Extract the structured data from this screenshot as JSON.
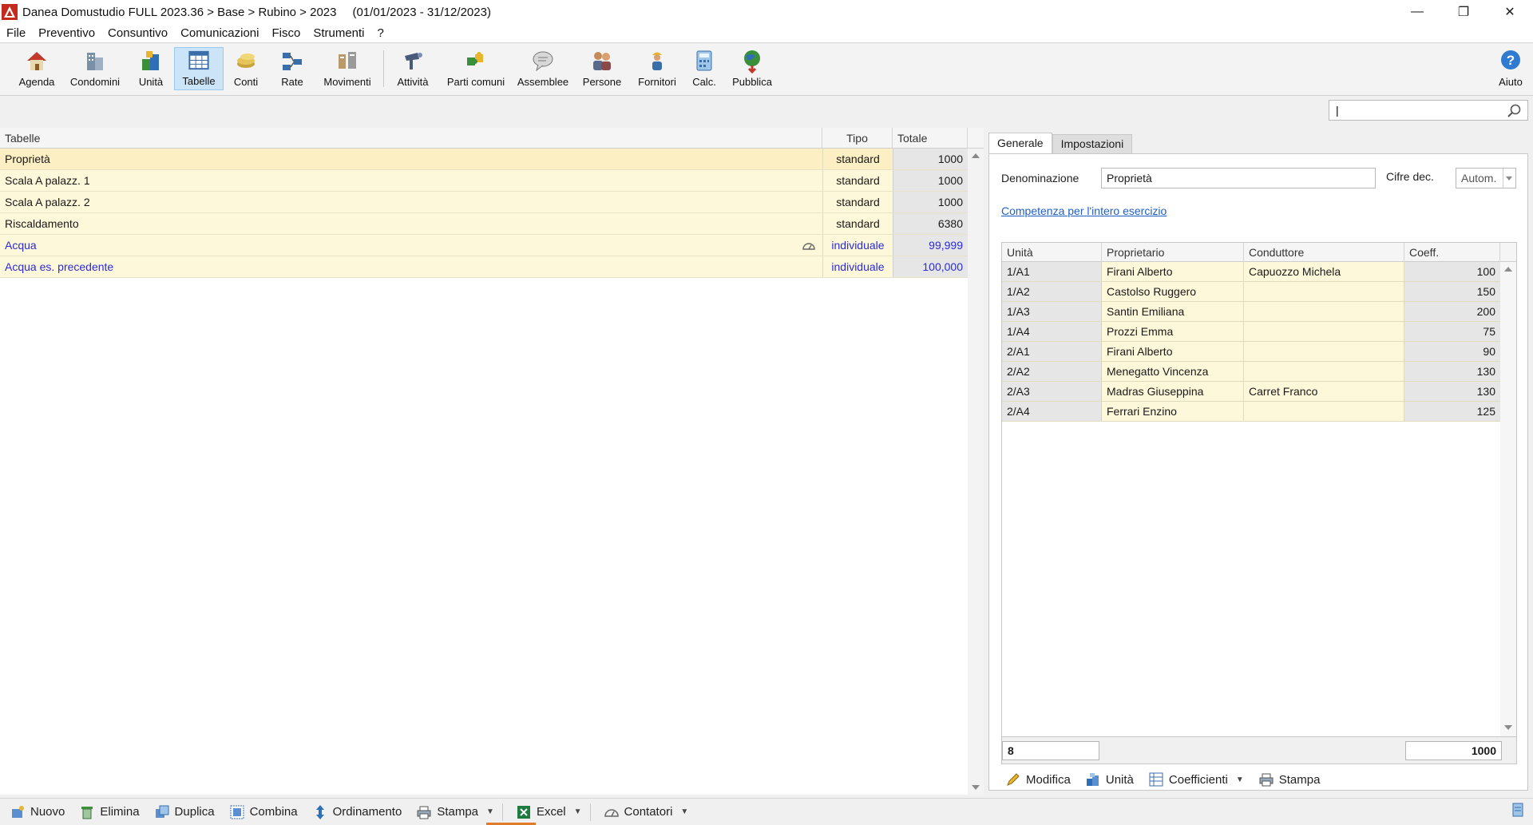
{
  "window": {
    "title": "Danea Domustudio FULL 2023.36 > Base > Rubino > 2023",
    "period": "(01/01/2023 - 31/12/2023)",
    "controls": {
      "minimize": "—",
      "restore": "❐",
      "close": "✕"
    }
  },
  "menu": [
    "File",
    "Preventivo",
    "Consuntivo",
    "Comunicazioni",
    "Fisco",
    "Strumenti",
    "?"
  ],
  "toolbar": {
    "agenda": "Agenda",
    "condomini": "Condomini",
    "unita": "Unità",
    "tabelle": "Tabelle",
    "conti": "Conti",
    "rate": "Rate",
    "movimenti": "Movimenti",
    "attivita": "Attività",
    "parti_comuni": "Parti comuni",
    "assemblee": "Assemblee",
    "persone": "Persone",
    "fornitori": "Fornitori",
    "calc": "Calc.",
    "pubblica": "Pubblica",
    "aiuto": "Aiuto",
    "active": "Tabelle"
  },
  "search": {
    "value": "|"
  },
  "tables": {
    "columns": {
      "name": "Tabelle",
      "tipo": "Tipo",
      "totale": "Totale"
    },
    "rows": [
      {
        "name": "Proprietà",
        "tipo": "standard",
        "totale": "1000"
      },
      {
        "name": "Scala A palazz. 1",
        "tipo": "standard",
        "totale": "1000"
      },
      {
        "name": "Scala A palazz. 2",
        "tipo": "standard",
        "totale": "1000"
      },
      {
        "name": "Riscaldamento",
        "tipo": "standard",
        "totale": "6380"
      },
      {
        "name": "Acqua",
        "tipo": "individuale",
        "totale": "99,999"
      },
      {
        "name": "Acqua es. precedente",
        "tipo": "individuale",
        "totale": "100,000"
      }
    ]
  },
  "detail": {
    "tabs": {
      "generale": "Generale",
      "impostazioni": "Impostazioni"
    },
    "denominazione_label": "Denominazione",
    "denominazione_value": "Proprietà",
    "cifre_label": "Cifre dec.",
    "cifre_value": "Autom.",
    "competenza_link": "Competenza per l'intero esercizio",
    "grid": {
      "columns": {
        "unita": "Unità",
        "proprietario": "Proprietario",
        "conduttore": "Conduttore",
        "coeff": "Coeff."
      },
      "rows": [
        {
          "unita": "1/A1",
          "proprietario": "Firani Alberto",
          "conduttore": "Capuozzo Michela",
          "coeff": "100"
        },
        {
          "unita": "1/A2",
          "proprietario": "Castolso Ruggero",
          "conduttore": "",
          "coeff": "150"
        },
        {
          "unita": "1/A3",
          "proprietario": "Santin Emiliana",
          "conduttore": "",
          "coeff": "200"
        },
        {
          "unita": "1/A4",
          "proprietario": "Prozzi Emma",
          "conduttore": "",
          "coeff": "75"
        },
        {
          "unita": "2/A1",
          "proprietario": "Firani Alberto",
          "conduttore": "",
          "coeff": "90"
        },
        {
          "unita": "2/A2",
          "proprietario": "Menegatto Vincenza",
          "conduttore": "",
          "coeff": "130"
        },
        {
          "unita": "2/A3",
          "proprietario": "Madras Giuseppina",
          "conduttore": "Carret Franco",
          "coeff": "130"
        },
        {
          "unita": "2/A4",
          "proprietario": "Ferrari Enzino",
          "conduttore": "",
          "coeff": "125"
        }
      ],
      "count": "8",
      "total": "1000"
    },
    "actions": {
      "modifica": "Modifica",
      "unita": "Unità",
      "coefficienti": "Coefficienti",
      "stampa": "Stampa"
    }
  },
  "bottom": {
    "nuovo": "Nuovo",
    "elimina": "Elimina",
    "duplica": "Duplica",
    "combina": "Combina",
    "ordinamento": "Ordinamento",
    "stampa": "Stampa",
    "excel": "Excel",
    "contatori": "Contatori"
  },
  "colors": {
    "row_bg": "#fdf8d9",
    "selected_row": "#fcefc3",
    "link_blue": "#2b2bd8",
    "accent": "#cce4f7"
  }
}
